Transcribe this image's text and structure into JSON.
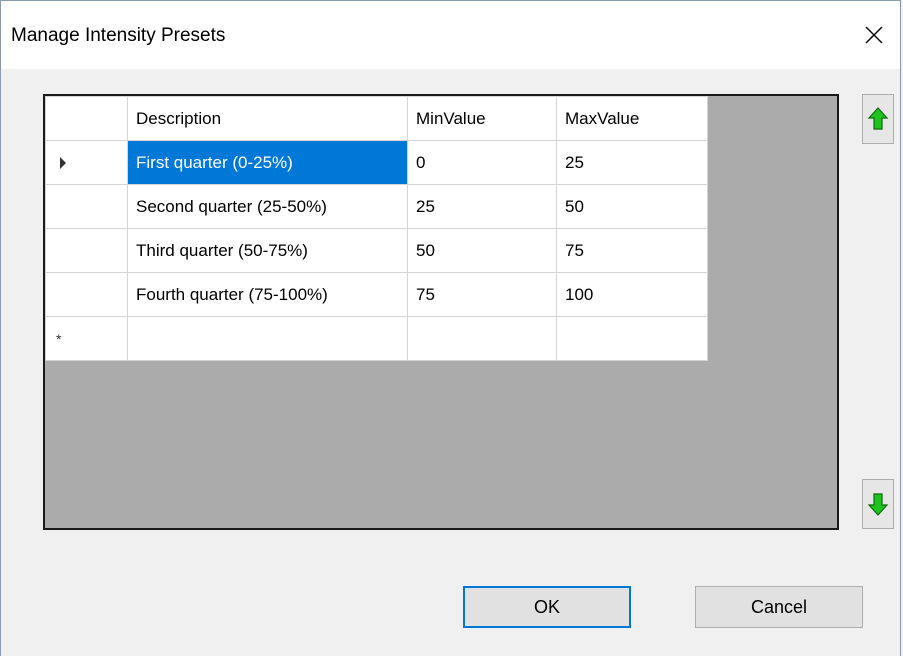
{
  "window": {
    "title": "Manage Intensity Presets",
    "close_icon": "close-icon"
  },
  "grid": {
    "columns": [
      "Description",
      "MinValue",
      "MaxValue"
    ],
    "rows": [
      {
        "description": "First quarter (0-25%)",
        "min": "0",
        "max": "25",
        "selected": true
      },
      {
        "description": "Second quarter (25-50%)",
        "min": "25",
        "max": "50"
      },
      {
        "description": "Third quarter (50-75%)",
        "min": "50",
        "max": "75"
      },
      {
        "description": "Fourth quarter (75-100%)",
        "min": "75",
        "max": "100"
      }
    ],
    "new_row_marker": "*",
    "current_row_marker": "triangle-right-icon"
  },
  "side_buttons": {
    "up_icon": "arrow-up-icon",
    "down_icon": "arrow-down-icon",
    "accent": "#1fc21f"
  },
  "footer": {
    "ok_label": "OK",
    "cancel_label": "Cancel"
  },
  "colors": {
    "selection": "#0078d7",
    "grid_background": "#ababab"
  }
}
